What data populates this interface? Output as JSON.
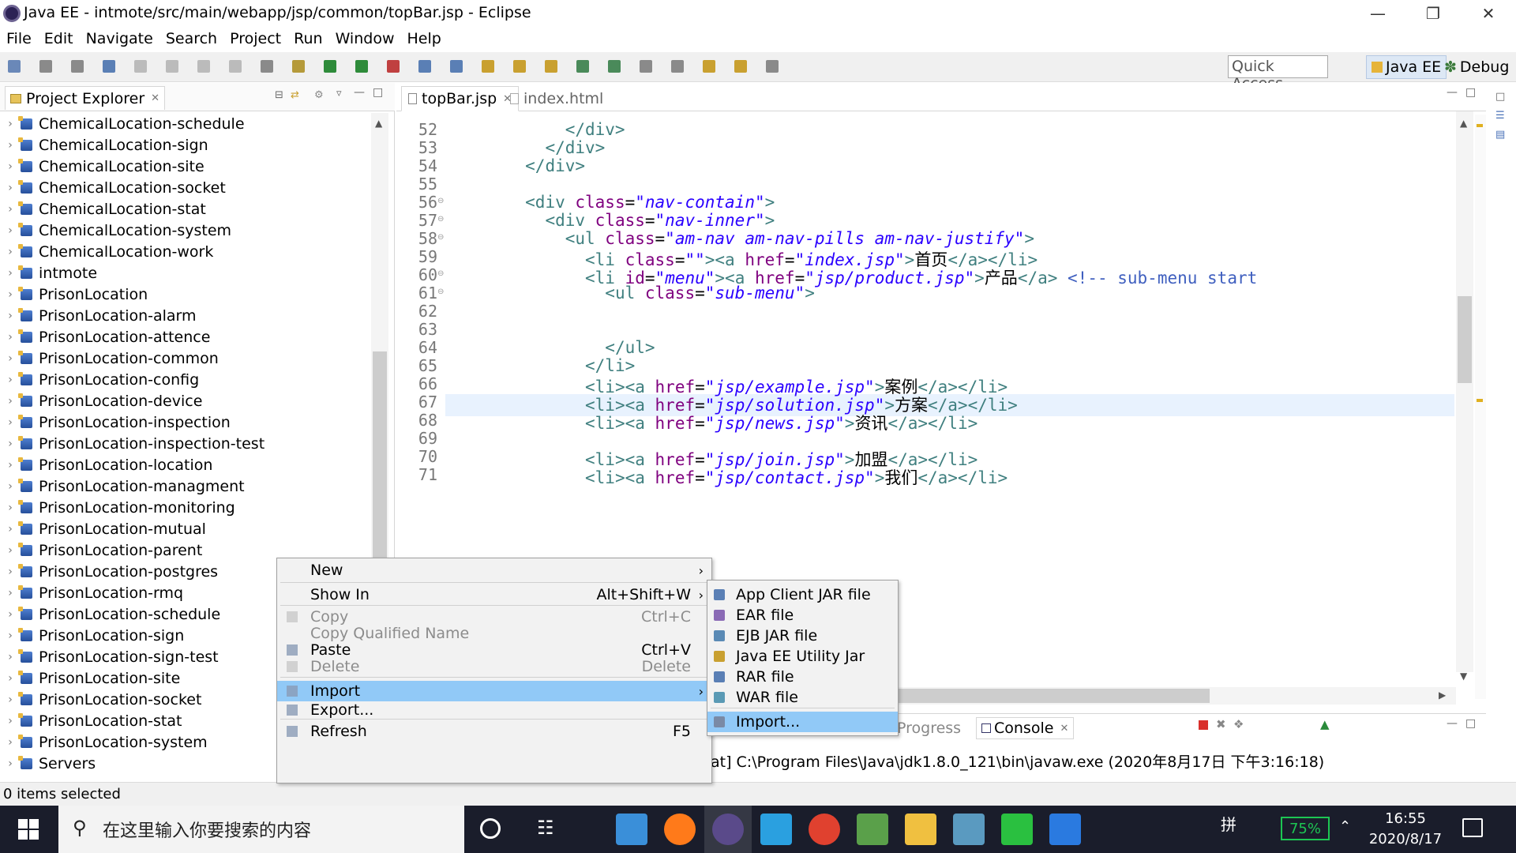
{
  "window": {
    "title": "Java EE - intmote/src/main/webapp/jsp/common/topBar.jsp - Eclipse"
  },
  "menubar": [
    "File",
    "Edit",
    "Navigate",
    "Search",
    "Project",
    "Run",
    "Window",
    "Help"
  ],
  "toolbar": {
    "quick_access": "Quick Access",
    "perspectives": [
      "Java EE",
      "Debug"
    ]
  },
  "explorer": {
    "tab_label": "Project Explorer",
    "items": [
      "ChemicalLocation-schedule",
      "ChemicalLocation-sign",
      "ChemicalLocation-site",
      "ChemicalLocation-socket",
      "ChemicalLocation-stat",
      "ChemicalLocation-system",
      "ChemicalLocation-work",
      "intmote",
      "PrisonLocation",
      "PrisonLocation-alarm",
      "PrisonLocation-attence",
      "PrisonLocation-common",
      "PrisonLocation-config",
      "PrisonLocation-device",
      "PrisonLocation-inspection",
      "PrisonLocation-inspection-test",
      "PrisonLocation-location",
      "PrisonLocation-managment",
      "PrisonLocation-monitoring",
      "PrisonLocation-mutual",
      "PrisonLocation-parent",
      "PrisonLocation-postgres",
      "PrisonLocation-rmq",
      "PrisonLocation-schedule",
      "PrisonLocation-sign",
      "PrisonLocation-sign-test",
      "PrisonLocation-site",
      "PrisonLocation-socket",
      "PrisonLocation-stat",
      "PrisonLocation-system",
      "Servers"
    ]
  },
  "editor": {
    "tabs": [
      {
        "label": "topBar.jsp",
        "active": true
      },
      {
        "label": "index.html",
        "active": false
      }
    ],
    "current_line": 61,
    "lines": [
      {
        "num": "52",
        "fold": false,
        "parts": [
          [
            "txt",
            "            "
          ],
          [
            "tag",
            "</div>"
          ]
        ]
      },
      {
        "num": "53",
        "fold": false,
        "parts": [
          [
            "txt",
            "          "
          ],
          [
            "tag",
            "</div>"
          ]
        ]
      },
      {
        "num": "54",
        "fold": false,
        "parts": [
          [
            "txt",
            "        "
          ],
          [
            "tag",
            "</div>"
          ]
        ]
      },
      {
        "num": "55",
        "fold": false,
        "parts": []
      },
      {
        "num": "56",
        "fold": true,
        "parts": [
          [
            "txt",
            "        "
          ],
          [
            "tag",
            "<div "
          ],
          [
            "att",
            "class"
          ],
          [
            "txt",
            "="
          ],
          [
            "val",
            "\"nav-contain\""
          ],
          [
            "tag",
            ">"
          ]
        ]
      },
      {
        "num": "57",
        "fold": true,
        "parts": [
          [
            "txt",
            "          "
          ],
          [
            "tag",
            "<div "
          ],
          [
            "att",
            "class"
          ],
          [
            "txt",
            "="
          ],
          [
            "val",
            "\"nav-inner\""
          ],
          [
            "tag",
            ">"
          ]
        ]
      },
      {
        "num": "58",
        "fold": true,
        "parts": [
          [
            "txt",
            "            "
          ],
          [
            "tag",
            "<ul "
          ],
          [
            "att",
            "class"
          ],
          [
            "txt",
            "="
          ],
          [
            "val",
            "\"am-nav am-nav-pills am-nav-justify\""
          ],
          [
            "tag",
            ">"
          ]
        ]
      },
      {
        "num": "59",
        "fold": false,
        "parts": [
          [
            "txt",
            "              "
          ],
          [
            "tag",
            "<li "
          ],
          [
            "att",
            "class"
          ],
          [
            "txt",
            "="
          ],
          [
            "val",
            "\"\""
          ],
          [
            "tag",
            "><a "
          ],
          [
            "att",
            "href"
          ],
          [
            "txt",
            "="
          ],
          [
            "val",
            "\"index.jsp\""
          ],
          [
            "tag",
            ">"
          ],
          [
            "txt",
            "首页"
          ],
          [
            "tag",
            "</a></li>"
          ]
        ]
      },
      {
        "num": "60",
        "fold": true,
        "parts": [
          [
            "txt",
            "              "
          ],
          [
            "tag",
            "<li "
          ],
          [
            "att",
            "id"
          ],
          [
            "txt",
            "="
          ],
          [
            "val",
            "\"menu\""
          ],
          [
            "tag",
            "><a "
          ],
          [
            "att",
            "href"
          ],
          [
            "txt",
            "="
          ],
          [
            "val",
            "\"jsp/product.jsp\""
          ],
          [
            "tag",
            ">"
          ],
          [
            "txt",
            "产品"
          ],
          [
            "tag",
            "</a> "
          ],
          [
            "cmt",
            "<!-- sub-menu start"
          ]
        ]
      },
      {
        "num": "61",
        "fold": true,
        "parts": [
          [
            "txt",
            "                "
          ],
          [
            "tag",
            "<ul "
          ],
          [
            "att",
            "class"
          ],
          [
            "txt",
            "="
          ],
          [
            "val",
            "\"sub-menu\""
          ],
          [
            "tag",
            ">"
          ]
        ]
      },
      {
        "num": "62",
        "fold": false,
        "parts": []
      },
      {
        "num": "63",
        "fold": false,
        "parts": []
      },
      {
        "num": "64",
        "fold": false,
        "parts": [
          [
            "txt",
            "                "
          ],
          [
            "tag",
            "</ul>"
          ]
        ]
      },
      {
        "num": "65",
        "fold": false,
        "parts": [
          [
            "txt",
            "              "
          ],
          [
            "tag",
            "</li>"
          ]
        ]
      },
      {
        "num": "66",
        "fold": false,
        "parts": [
          [
            "txt",
            "              "
          ],
          [
            "tag",
            "<li><a "
          ],
          [
            "att",
            "href"
          ],
          [
            "txt",
            "="
          ],
          [
            "val",
            "\"jsp/example.jsp\""
          ],
          [
            "tag",
            ">"
          ],
          [
            "txt",
            "案例"
          ],
          [
            "tag",
            "</a></li>"
          ]
        ]
      },
      {
        "num": "67",
        "fold": false,
        "parts": [
          [
            "txt",
            "              "
          ],
          [
            "tag",
            "<li><a "
          ],
          [
            "att",
            "href"
          ],
          [
            "txt",
            "="
          ],
          [
            "val",
            "\"jsp/solution.jsp\""
          ],
          [
            "tag",
            ">"
          ],
          [
            "txt",
            "方案"
          ],
          [
            "tag",
            "</a></li>"
          ]
        ]
      },
      {
        "num": "68",
        "fold": false,
        "parts": [
          [
            "txt",
            "              "
          ],
          [
            "tag",
            "<li><a "
          ],
          [
            "att",
            "href"
          ],
          [
            "txt",
            "="
          ],
          [
            "val",
            "\"jsp/news.jsp\""
          ],
          [
            "tag",
            ">"
          ],
          [
            "txt",
            "资讯"
          ],
          [
            "tag",
            "</a></li>"
          ]
        ]
      },
      {
        "num": "69",
        "fold": false,
        "parts": []
      },
      {
        "num": "70",
        "fold": false,
        "parts": [
          [
            "txt",
            "              "
          ],
          [
            "tag",
            "<li><a "
          ],
          [
            "att",
            "href"
          ],
          [
            "txt",
            "="
          ],
          [
            "val",
            "\"jsp/join.jsp\""
          ],
          [
            "tag",
            ">"
          ],
          [
            "txt",
            "加盟"
          ],
          [
            "tag",
            "</a></li>"
          ]
        ]
      },
      {
        "num": "71",
        "fold": false,
        "parts": [
          [
            "txt",
            "              "
          ],
          [
            "tag",
            "<li><a "
          ],
          [
            "att",
            "href"
          ],
          [
            "txt",
            "="
          ],
          [
            "val",
            "\"jsp/contact.jsp\""
          ],
          [
            "tag",
            ">"
          ],
          [
            "txt",
            "我们"
          ],
          [
            "tag",
            "</a></li>"
          ]
        ]
      }
    ],
    "partial_line_fragment": ">"
  },
  "console": {
    "tabs": [
      "Progress",
      "Console"
    ],
    "line": "at] C:\\Program Files\\Java\\jdk1.8.0_121\\bin\\javaw.exe (2020年8月17日 下午3:16:18)"
  },
  "context_menu": {
    "items": [
      {
        "label": "New",
        "shortcut": "",
        "submenu": true,
        "disabled": false,
        "highlighted": false,
        "icon": ""
      },
      {
        "label": "Show In",
        "shortcut": "Alt+Shift+W",
        "submenu": true,
        "disabled": false,
        "highlighted": false,
        "icon": ""
      },
      {
        "label": "Copy",
        "shortcut": "Ctrl+C",
        "submenu": false,
        "disabled": true,
        "highlighted": false,
        "icon": "copy-icon"
      },
      {
        "label": "Copy Qualified Name",
        "shortcut": "",
        "submenu": false,
        "disabled": true,
        "highlighted": false,
        "icon": ""
      },
      {
        "label": "Paste",
        "shortcut": "Ctrl+V",
        "submenu": false,
        "disabled": false,
        "highlighted": false,
        "icon": "paste-icon"
      },
      {
        "label": "Delete",
        "shortcut": "Delete",
        "submenu": false,
        "disabled": true,
        "highlighted": false,
        "icon": "delete-icon"
      },
      {
        "label": "Import",
        "shortcut": "",
        "submenu": true,
        "disabled": false,
        "highlighted": true,
        "icon": "import-icon"
      },
      {
        "label": "Export...",
        "shortcut": "",
        "submenu": false,
        "disabled": false,
        "highlighted": false,
        "icon": "export-icon"
      },
      {
        "label": "Refresh",
        "shortcut": "F5",
        "submenu": false,
        "disabled": false,
        "highlighted": false,
        "icon": "refresh-icon"
      }
    ]
  },
  "submenu": {
    "items": [
      {
        "label": "App Client JAR file",
        "highlighted": false
      },
      {
        "label": "EAR file",
        "highlighted": false
      },
      {
        "label": "EJB JAR file",
        "highlighted": false
      },
      {
        "label": "Java EE Utility Jar",
        "highlighted": false
      },
      {
        "label": "RAR file",
        "highlighted": false
      },
      {
        "label": "WAR file",
        "highlighted": false
      },
      {
        "label": "Import...",
        "highlighted": true
      }
    ]
  },
  "statusbar": {
    "text": "0 items selected"
  },
  "taskbar": {
    "search_placeholder": "在这里输入你要搜索的内容",
    "battery": "75%",
    "ime": "拼",
    "time": "16:55",
    "date": "2020/8/17",
    "apps": [
      "remote-desktop-icon",
      "firefox-icon",
      "eclipse-icon",
      "search-app-icon",
      "chrome-icon",
      "app-icon",
      "file-explorer-icon",
      "notepad-icon",
      "wechat-icon",
      "feishu-icon"
    ]
  },
  "colors": {
    "highlight": "#91c9f7",
    "tag": "#3f7f7f",
    "attribute": "#7f007f",
    "value": "#2a00ff",
    "comment": "#3f5fbf"
  }
}
